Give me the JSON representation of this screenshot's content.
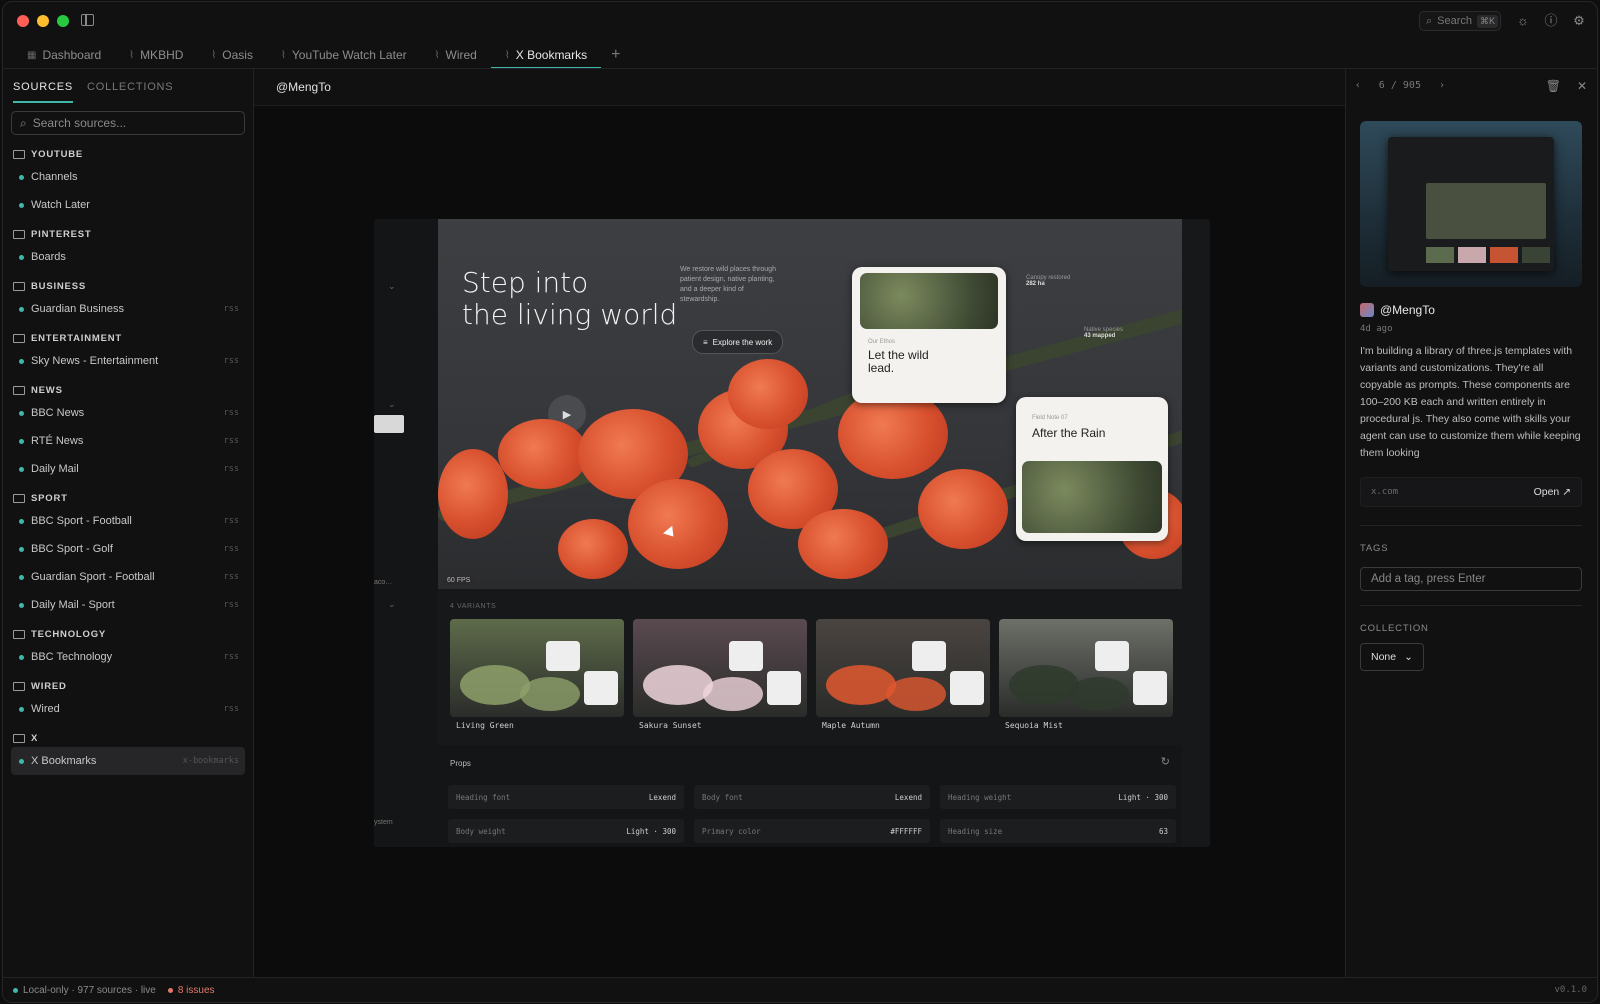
{
  "colors": {
    "accent": "#3fb7a9",
    "traffic_red": "#ff5f57",
    "traffic_yellow": "#febc2e",
    "traffic_green": "#28c840",
    "issues": "#e3786a",
    "autumn": "#e0582f"
  },
  "titlebar": {
    "search_label": "Search",
    "search_shortcut": "⌘K"
  },
  "tabs": [
    {
      "label": "Dashboard",
      "icon": "grid-icon"
    },
    {
      "label": "MKBHD",
      "icon": "rss-icon"
    },
    {
      "label": "Oasis",
      "icon": "rss-icon"
    },
    {
      "label": "YouTube Watch Later",
      "icon": "rss-icon"
    },
    {
      "label": "Wired",
      "icon": "rss-icon"
    },
    {
      "label": "X Bookmarks",
      "icon": "rss-icon",
      "active": true
    }
  ],
  "sidebar": {
    "tab_sources": "SOURCES",
    "tab_collections": "COLLECTIONS",
    "search_placeholder": "Search sources...",
    "groups": [
      {
        "name": "YOUTUBE",
        "items": [
          {
            "label": "Channels",
            "tag": ""
          },
          {
            "label": "Watch Later",
            "tag": ""
          }
        ]
      },
      {
        "name": "PINTEREST",
        "items": [
          {
            "label": "Boards",
            "tag": ""
          }
        ]
      },
      {
        "name": "BUSINESS",
        "items": [
          {
            "label": "Guardian Business",
            "tag": "rss"
          }
        ]
      },
      {
        "name": "ENTERTAINMENT",
        "items": [
          {
            "label": "Sky News - Entertainment",
            "tag": "rss"
          }
        ]
      },
      {
        "name": "NEWS",
        "items": [
          {
            "label": "BBC News",
            "tag": "rss"
          },
          {
            "label": "RTÉ News",
            "tag": "rss"
          },
          {
            "label": "Daily Mail",
            "tag": "rss"
          }
        ]
      },
      {
        "name": "SPORT",
        "items": [
          {
            "label": "BBC Sport - Football",
            "tag": "rss"
          },
          {
            "label": "BBC Sport - Golf",
            "tag": "rss"
          },
          {
            "label": "Guardian Sport - Football",
            "tag": "rss"
          },
          {
            "label": "Daily Mail - Sport",
            "tag": "rss"
          }
        ]
      },
      {
        "name": "TECHNOLOGY",
        "items": [
          {
            "label": "BBC Technology",
            "tag": "rss"
          }
        ]
      },
      {
        "name": "WIRED",
        "items": [
          {
            "label": "Wired",
            "tag": "rss"
          }
        ]
      },
      {
        "name": "X",
        "items": [
          {
            "label": "X Bookmarks",
            "tag": "x-bookmarks",
            "active": true
          }
        ]
      }
    ]
  },
  "main": {
    "title": "@MengTo",
    "pager": {
      "current": "6",
      "sep": "/",
      "total": "905"
    },
    "media": {
      "hero_line1": "Step into",
      "hero_line2": "the living world",
      "hero_copy": "We restore wild places through patient design, native planting, and a deeper kind of stewardship.",
      "hero_button": "Explore the work",
      "card1_kicker": "Our Ethos",
      "card1_title_1": "Let the wild",
      "card1_title_2": "lead.",
      "card2_kicker": "Field Note 07",
      "card2_title": "After the Rain",
      "stat1_label": "Canopy restored",
      "stat1_value": "282 ha",
      "stat2_label": "Native species",
      "stat2_value": "43 mapped",
      "fps": "60 FPS",
      "variants_label": "4 VARIANTS",
      "variants": [
        {
          "name": "Living Green",
          "tint": "#5e6b4a",
          "bloom": "#8fa06a"
        },
        {
          "name": "Sakura Sunset",
          "tint": "#5a4a50",
          "bloom": "#f0d6dc"
        },
        {
          "name": "Maple Autumn",
          "tint": "#4a4440",
          "bloom": "#e0582f"
        },
        {
          "name": "Sequoia Mist",
          "tint": "#6c7068",
          "bloom": "#2e3a2c"
        }
      ],
      "props_title": "Props",
      "props": [
        {
          "key": "Heading font",
          "value": "Lexend"
        },
        {
          "key": "Body font",
          "value": "Lexend"
        },
        {
          "key": "Heading weight",
          "value": "Light · 300"
        },
        {
          "key": "Body weight",
          "value": "Light · 300"
        },
        {
          "key": "Primary color",
          "value": "#FFFFFF"
        },
        {
          "key": "Heading size",
          "value": "63"
        }
      ],
      "left_label": "aco…",
      "left_label2": "ystem"
    }
  },
  "detail": {
    "author": "@MengTo",
    "time": "4d ago",
    "description": "I'm building a library of three.js templates with variants and customizations. They're all copyable as prompts. These components are 100–200 KB each and written entirely in procedural js. They also come with skills your agent can use to customize them while keeping them looking",
    "domain": "x.com",
    "open_label": "Open",
    "tags_label": "TAGS",
    "tag_placeholder": "Add a tag, press Enter",
    "collection_label": "COLLECTION",
    "collection_value": "None"
  },
  "status": {
    "left": "Local-only · 977 sources · live",
    "issues": "8 issues",
    "version": "v0.1.0"
  }
}
